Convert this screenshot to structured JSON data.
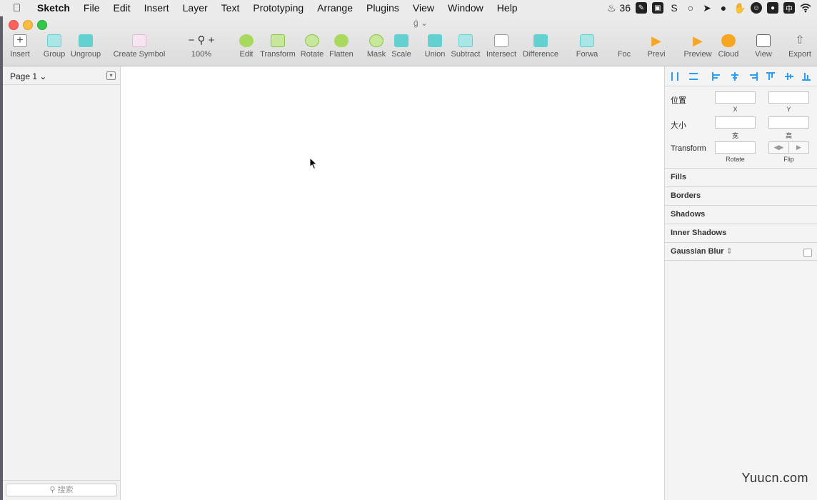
{
  "menubar": {
    "app_name": "Sketch",
    "items": [
      "File",
      "Edit",
      "Insert",
      "Layer",
      "Text",
      "Prototyping",
      "Arrange",
      "Plugins",
      "View",
      "Window",
      "Help"
    ],
    "notification_count": "36"
  },
  "window": {
    "title": "ǵ"
  },
  "toolbar": {
    "insert": "Insert",
    "group": "Group",
    "ungroup": "Ungroup",
    "create_symbol": "Create Symbol",
    "zoom": "100%",
    "edit": "Edit",
    "transform": "Transform",
    "rotate": "Rotate",
    "flatten": "Flatten",
    "mask": "Mask",
    "scale": "Scale",
    "union": "Union",
    "subtract": "Subtract",
    "intersect": "Intersect",
    "difference": "Difference",
    "forward": "Forwa",
    "focus": "Foc",
    "preview_link": "Previ",
    "preview": "Preview",
    "cloud": "Cloud",
    "view": "View",
    "export": "Export"
  },
  "left_panel": {
    "page": "Page 1",
    "search_placeholder": "搜索"
  },
  "inspector": {
    "position_label": "位置",
    "x_label": "X",
    "y_label": "Y",
    "size_label": "大小",
    "width_label": "宽",
    "height_label": "高",
    "transform_label": "Transform",
    "rotate_label": "Rotate",
    "flip_label": "Flip",
    "sections": {
      "fills": "Fills",
      "borders": "Borders",
      "shadows": "Shadows",
      "inner_shadows": "Inner Shadows",
      "gaussian_blur": "Gaussian Blur"
    }
  },
  "watermark": "Yuucn.com"
}
